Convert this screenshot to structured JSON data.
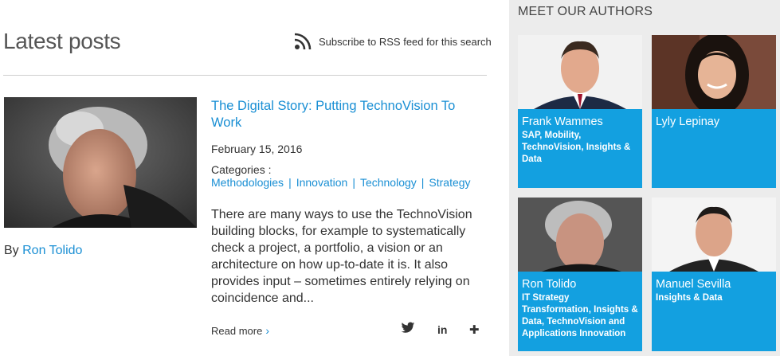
{
  "main": {
    "title": "Latest posts",
    "rss_label": "Subscribe to RSS feed for this search"
  },
  "post": {
    "author_prefix": "By",
    "author": "Ron Tolido",
    "title": "The Digital Story: Putting TechnoVision To Work",
    "date": "February 15, 2016",
    "categories_label": "Categories :",
    "categories": [
      "Methodologies",
      "Innovation",
      "Technology",
      "Strategy"
    ],
    "excerpt": "There are many ways to use the TechnoVision building blocks, for example to systematically check a project, a portfolio, a vision or an architecture on how up-to-date it is. It also provides input – sometimes entirely relying on coincidence and...",
    "read_more": "Read more",
    "share_icons": [
      "twitter-icon",
      "linkedin-icon",
      "plus-icon"
    ],
    "share_labels": {
      "linkedin": "in",
      "plus": "✚"
    }
  },
  "sidebar": {
    "title": "MEET OUR AUTHORS",
    "authors": [
      {
        "name": "Frank Wammes",
        "role": "SAP, Mobility, TechnoVision, Insights & Data"
      },
      {
        "name": "Lyly Lepinay",
        "role": ""
      },
      {
        "name": "Ron Tolido",
        "role": "IT Strategy Transformation, Insights & Data, TechnoVision and Applications Innovation"
      },
      {
        "name": "Manuel Sevilla",
        "role": "Insights & Data"
      }
    ]
  },
  "colors": {
    "accent": "#1a8fd4",
    "card_blue": "#13a0e0",
    "sidebar_bg": "#ececec"
  }
}
